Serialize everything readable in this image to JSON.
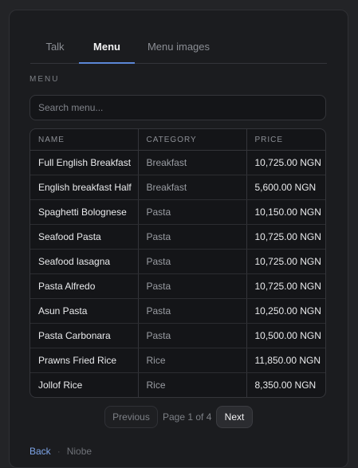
{
  "tabs": [
    {
      "label": "Talk",
      "active": false
    },
    {
      "label": "Menu",
      "active": true
    },
    {
      "label": "Menu images",
      "active": false
    }
  ],
  "section_label": "MENU",
  "search": {
    "placeholder": "Search menu...",
    "value": ""
  },
  "table": {
    "columns": [
      "NAME",
      "CATEGORY",
      "PRICE"
    ],
    "rows": [
      {
        "name": "Full English Breakfast",
        "category": "Breakfast",
        "price": "10,725.00 NGN"
      },
      {
        "name": "English breakfast Half",
        "category": "Breakfast",
        "price": "5,600.00 NGN"
      },
      {
        "name": "Spaghetti Bolognese",
        "category": "Pasta",
        "price": "10,150.00 NGN"
      },
      {
        "name": "Seafood Pasta",
        "category": "Pasta",
        "price": "10,725.00 NGN"
      },
      {
        "name": "Seafood lasagna",
        "category": "Pasta",
        "price": "10,725.00 NGN"
      },
      {
        "name": "Pasta Alfredo",
        "category": "Pasta",
        "price": "10,725.00 NGN"
      },
      {
        "name": "Asun Pasta",
        "category": "Pasta",
        "price": "10,250.00 NGN"
      },
      {
        "name": "Pasta Carbonara",
        "category": "Pasta",
        "price": "10,500.00 NGN"
      },
      {
        "name": "Prawns Fried Rice",
        "category": "Rice",
        "price": "11,850.00 NGN"
      },
      {
        "name": "Jollof Rice",
        "category": "Rice",
        "price": "8,350.00 NGN"
      }
    ]
  },
  "pagination": {
    "prev_label": "Previous",
    "page_info": "Page 1 of 4",
    "next_label": "Next"
  },
  "footer": {
    "back_label": "Back",
    "separator": "·",
    "user_name": "Niobe"
  },
  "colors": {
    "background": "#232427",
    "panel": "#1b1c1f",
    "accent": "#5b87d6",
    "link": "#7ea5e8"
  }
}
